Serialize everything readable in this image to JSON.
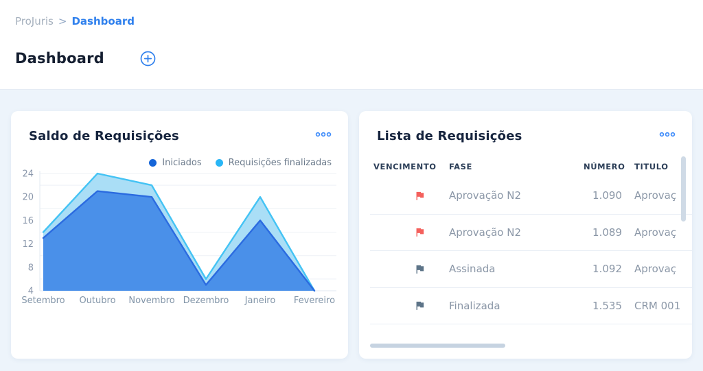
{
  "breadcrumb": {
    "root": "ProJuris",
    "separator": ">",
    "current": "Dashboard"
  },
  "page": {
    "title": "Dashboard"
  },
  "colors": {
    "accent": "#2f80ed",
    "flag_red": "#f4605c",
    "flag_slate": "#5d7488",
    "scrollbar": "#cfdae6"
  },
  "cards": {
    "chart": {
      "title": "Saldo de Requisições",
      "menu_icon": "kebab-horizontal"
    },
    "table": {
      "title": "Lista de Requisições",
      "columns": [
        "VENCIMENTO",
        "FASE",
        "NÚMERO",
        "TITULO"
      ],
      "rows": [
        {
          "flag": "red",
          "fase": "Aprovação N2",
          "numero": "1.090",
          "titulo": "Aprovaç"
        },
        {
          "flag": "red",
          "fase": "Aprovação N2",
          "numero": "1.089",
          "titulo": "Aprovaç"
        },
        {
          "flag": "slate",
          "fase": "Assinada",
          "numero": "1.092",
          "titulo": "Aprovaç"
        },
        {
          "flag": "slate",
          "fase": "Finalizada",
          "numero": "1.535",
          "titulo": "CRM 001"
        }
      ]
    }
  },
  "chart_data": {
    "type": "area",
    "title": "Saldo de Requisições",
    "categories": [
      "Setembro",
      "Outubro",
      "Novembro",
      "Dezembro",
      "Janeiro",
      "Fevereiro"
    ],
    "series": [
      {
        "name": "Iniciados",
        "values": [
          13,
          21,
          20,
          5,
          16,
          4
        ],
        "dot": "#1565d8",
        "stroke": "#2b6be0",
        "fill": "#4a90e9"
      },
      {
        "name": "Requisições finalizadas",
        "values": [
          14,
          24,
          22,
          6,
          20,
          4
        ],
        "dot": "#29b6f6",
        "stroke": "#44c3f4",
        "fill": "#aadef6"
      }
    ],
    "ylim": [
      4,
      24
    ],
    "yticks": [
      24,
      20,
      16,
      12,
      8,
      4
    ],
    "grid_values": [
      6,
      10,
      14,
      18,
      22,
      24
    ],
    "legend_position": "top-right",
    "xlabel": "",
    "ylabel": ""
  }
}
